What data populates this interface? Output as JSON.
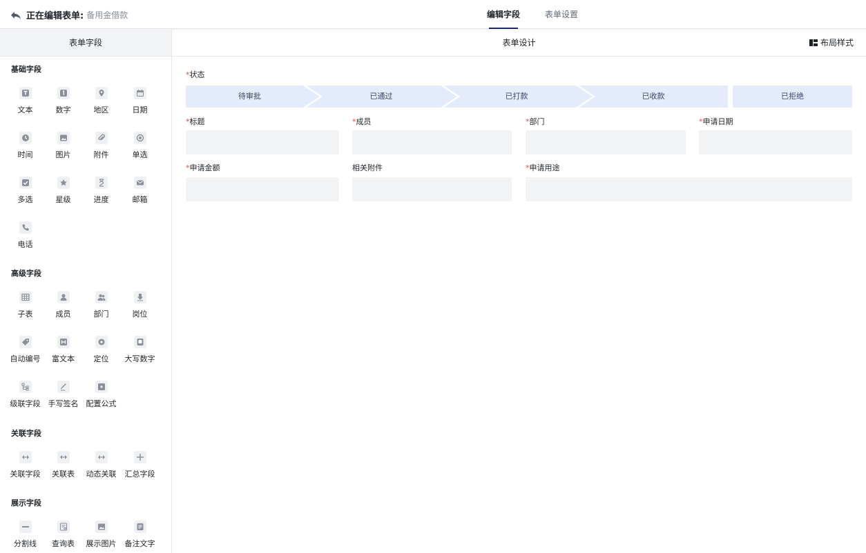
{
  "header": {
    "title": "正在编辑表单:",
    "form_name": "备用金借款",
    "tabs": [
      {
        "label": "编辑字段",
        "active": true
      },
      {
        "label": "表单设置",
        "active": false
      }
    ]
  },
  "sidebar": {
    "title": "表单字段",
    "groups": [
      {
        "title": "基础字段",
        "items": [
          {
            "label": "文本",
            "icon": "text-icon"
          },
          {
            "label": "数字",
            "icon": "number-icon"
          },
          {
            "label": "地区",
            "icon": "location-pin-icon"
          },
          {
            "label": "日期",
            "icon": "calendar-icon"
          },
          {
            "label": "时间",
            "icon": "clock-icon"
          },
          {
            "label": "图片",
            "icon": "image-icon"
          },
          {
            "label": "附件",
            "icon": "paperclip-icon"
          },
          {
            "label": "单选",
            "icon": "radio-icon"
          },
          {
            "label": "多选",
            "icon": "checkbox-icon"
          },
          {
            "label": "星级",
            "icon": "star-icon"
          },
          {
            "label": "进度",
            "icon": "hourglass-icon"
          },
          {
            "label": "邮箱",
            "icon": "envelope-icon"
          },
          {
            "label": "电话",
            "icon": "phone-icon"
          }
        ]
      },
      {
        "title": "高级字段",
        "items": [
          {
            "label": "子表",
            "icon": "table-icon"
          },
          {
            "label": "成员",
            "icon": "user-icon"
          },
          {
            "label": "部门",
            "icon": "users-icon"
          },
          {
            "label": "岗位",
            "icon": "post-icon"
          },
          {
            "label": "自动编号",
            "icon": "tag-icon"
          },
          {
            "label": "富文本",
            "icon": "rich-text-icon"
          },
          {
            "label": "定位",
            "icon": "target-icon"
          },
          {
            "label": "大写数字",
            "icon": "uppercase-number-icon"
          },
          {
            "label": "级联字段",
            "icon": "tree-icon"
          },
          {
            "label": "手写签名",
            "icon": "pen-icon"
          },
          {
            "label": "配置公式",
            "icon": "formula-icon"
          }
        ]
      },
      {
        "title": "关联字段",
        "items": [
          {
            "label": "关联字段",
            "icon": "link-arrows-icon"
          },
          {
            "label": "关联表",
            "icon": "link-arrows-icon"
          },
          {
            "label": "动态关联",
            "icon": "link-arrows-icon"
          },
          {
            "label": "汇总字段",
            "icon": "plus-icon"
          }
        ]
      },
      {
        "title": "展示字段",
        "items": [
          {
            "label": "分割线",
            "icon": "divider-icon"
          },
          {
            "label": "查询表",
            "icon": "query-table-icon"
          },
          {
            "label": "展示图片",
            "icon": "image-icon"
          },
          {
            "label": "备注文字",
            "icon": "note-icon"
          }
        ]
      }
    ]
  },
  "main": {
    "title": "表单设计",
    "layout_label": "布局样式",
    "status_label": "状态",
    "stages": [
      "待审批",
      "已通过",
      "已打款",
      "已收款",
      "已拒绝"
    ],
    "fields_row1": [
      {
        "label": "标题",
        "required": true
      },
      {
        "label": "成员",
        "required": true
      },
      {
        "label": "部门",
        "required": true
      },
      {
        "label": "申请日期",
        "required": true
      }
    ],
    "fields_row2": [
      {
        "label": "申请金额",
        "required": true
      },
      {
        "label": "相关附件",
        "required": false
      },
      {
        "label": "申请用途",
        "required": true
      }
    ]
  },
  "colors": {
    "accent": "#1a2a5a",
    "required": "#e6502f",
    "stage_bg": "#e4ecfb",
    "field_bg": "#f2f3f5"
  }
}
